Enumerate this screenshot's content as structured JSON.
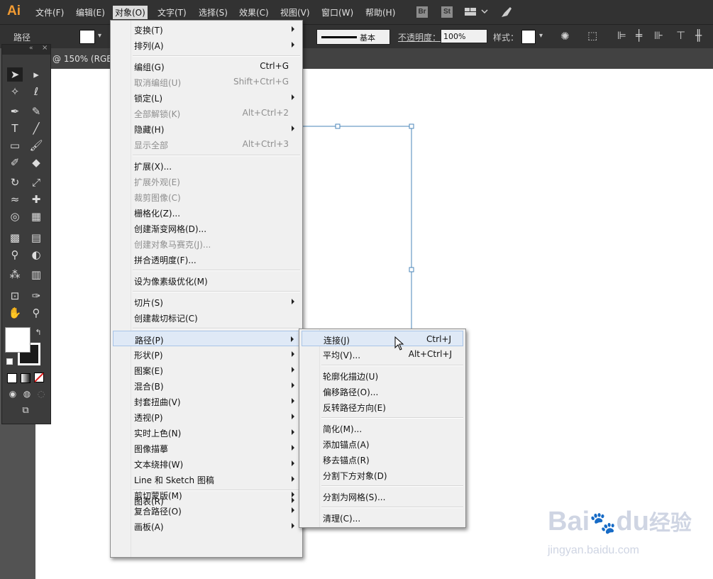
{
  "app": {
    "logo": "Ai"
  },
  "menubar": {
    "items": [
      {
        "label": "文件(F)"
      },
      {
        "label": "编辑(E)"
      },
      {
        "label": "对象(O)"
      },
      {
        "label": "文字(T)"
      },
      {
        "label": "选择(S)"
      },
      {
        "label": "效果(C)"
      },
      {
        "label": "视图(V)"
      },
      {
        "label": "窗口(W)"
      },
      {
        "label": "帮助(H)"
      }
    ],
    "bridge_badge": "Br",
    "stock_badge": "St"
  },
  "options": {
    "selection_type": "路径",
    "stroke_profile": "基本",
    "opacity_label": "不透明度：",
    "opacity_value": "100%",
    "style_label": "样式："
  },
  "document": {
    "tab_title": "@ 150% (RGB"
  },
  "object_menu": {
    "items": [
      {
        "label": "变换(T)",
        "shortcut": "",
        "submenu": true,
        "disabled": false
      },
      {
        "label": "排列(A)",
        "shortcut": "",
        "submenu": true,
        "disabled": false
      },
      {
        "label": "编组(G)",
        "shortcut": "Ctrl+G",
        "submenu": false,
        "disabled": false
      },
      {
        "label": "取消编组(U)",
        "shortcut": "Shift+Ctrl+G",
        "submenu": false,
        "disabled": true
      },
      {
        "label": "锁定(L)",
        "shortcut": "",
        "submenu": true,
        "disabled": false
      },
      {
        "label": "全部解锁(K)",
        "shortcut": "Alt+Ctrl+2",
        "submenu": false,
        "disabled": true
      },
      {
        "label": "隐藏(H)",
        "shortcut": "",
        "submenu": true,
        "disabled": false
      },
      {
        "label": "显示全部",
        "shortcut": "Alt+Ctrl+3",
        "submenu": false,
        "disabled": true
      },
      {
        "label": "扩展(X)...",
        "shortcut": "",
        "submenu": false,
        "disabled": false
      },
      {
        "label": "扩展外观(E)",
        "shortcut": "",
        "submenu": false,
        "disabled": true
      },
      {
        "label": "裁剪图像(C)",
        "shortcut": "",
        "submenu": false,
        "disabled": true
      },
      {
        "label": "栅格化(Z)...",
        "shortcut": "",
        "submenu": false,
        "disabled": false
      },
      {
        "label": "创建渐变网格(D)...",
        "shortcut": "",
        "submenu": false,
        "disabled": false
      },
      {
        "label": "创建对象马赛克(J)...",
        "shortcut": "",
        "submenu": false,
        "disabled": true
      },
      {
        "label": "拼合透明度(F)...",
        "shortcut": "",
        "submenu": false,
        "disabled": false
      },
      {
        "label": "设为像素级优化(M)",
        "shortcut": "",
        "submenu": false,
        "disabled": false
      },
      {
        "label": "切片(S)",
        "shortcut": "",
        "submenu": true,
        "disabled": false
      },
      {
        "label": "创建裁切标记(C)",
        "shortcut": "",
        "submenu": false,
        "disabled": false
      },
      {
        "label": "路径(P)",
        "shortcut": "",
        "submenu": true,
        "disabled": false,
        "highlighted": true
      },
      {
        "label": "形状(P)",
        "shortcut": "",
        "submenu": true,
        "disabled": false
      },
      {
        "label": "图案(E)",
        "shortcut": "",
        "submenu": true,
        "disabled": false
      },
      {
        "label": "混合(B)",
        "shortcut": "",
        "submenu": true,
        "disabled": false
      },
      {
        "label": "封套扭曲(V)",
        "shortcut": "",
        "submenu": true,
        "disabled": false
      },
      {
        "label": "透视(P)",
        "shortcut": "",
        "submenu": true,
        "disabled": false
      },
      {
        "label": "实时上色(N)",
        "shortcut": "",
        "submenu": true,
        "disabled": false
      },
      {
        "label": "图像描摹",
        "shortcut": "",
        "submenu": true,
        "disabled": false
      },
      {
        "label": "文本绕排(W)",
        "shortcut": "",
        "submenu": true,
        "disabled": false
      },
      {
        "label": "Line 和 Sketch 图稿",
        "shortcut": "",
        "submenu": true,
        "disabled": false
      },
      {
        "label": "剪切蒙版(M)",
        "shortcut": "",
        "submenu": true,
        "disabled": false
      },
      {
        "label": "复合路径(O)",
        "shortcut": "",
        "submenu": true,
        "disabled": false
      },
      {
        "label": "画板(A)",
        "shortcut": "",
        "submenu": true,
        "disabled": false
      },
      {
        "label": "图表(R)",
        "shortcut": "",
        "submenu": true,
        "disabled": false
      }
    ]
  },
  "path_submenu": {
    "items": [
      {
        "label": "连接(J)",
        "shortcut": "Ctrl+J",
        "highlighted": true
      },
      {
        "label": "平均(V)...",
        "shortcut": "Alt+Ctrl+J"
      },
      {
        "label": "轮廓化描边(U)",
        "shortcut": ""
      },
      {
        "label": "偏移路径(O)...",
        "shortcut": ""
      },
      {
        "label": "反转路径方向(E)",
        "shortcut": ""
      },
      {
        "label": "简化(M)...",
        "shortcut": ""
      },
      {
        "label": "添加锚点(A)",
        "shortcut": ""
      },
      {
        "label": "移去锚点(R)",
        "shortcut": ""
      },
      {
        "label": "分割下方对象(D)",
        "shortcut": ""
      },
      {
        "label": "分割为网格(S)...",
        "shortcut": ""
      },
      {
        "label": "清理(C)...",
        "shortcut": ""
      }
    ]
  },
  "watermark": {
    "brand": "Bai",
    "brand2": "du",
    "cn": "经验",
    "url": "jingyan.baidu.com"
  },
  "colors": {
    "accent": "#f29b32",
    "menu_highlight": "#dfe9f6",
    "path_stroke": "#4a86b8"
  }
}
